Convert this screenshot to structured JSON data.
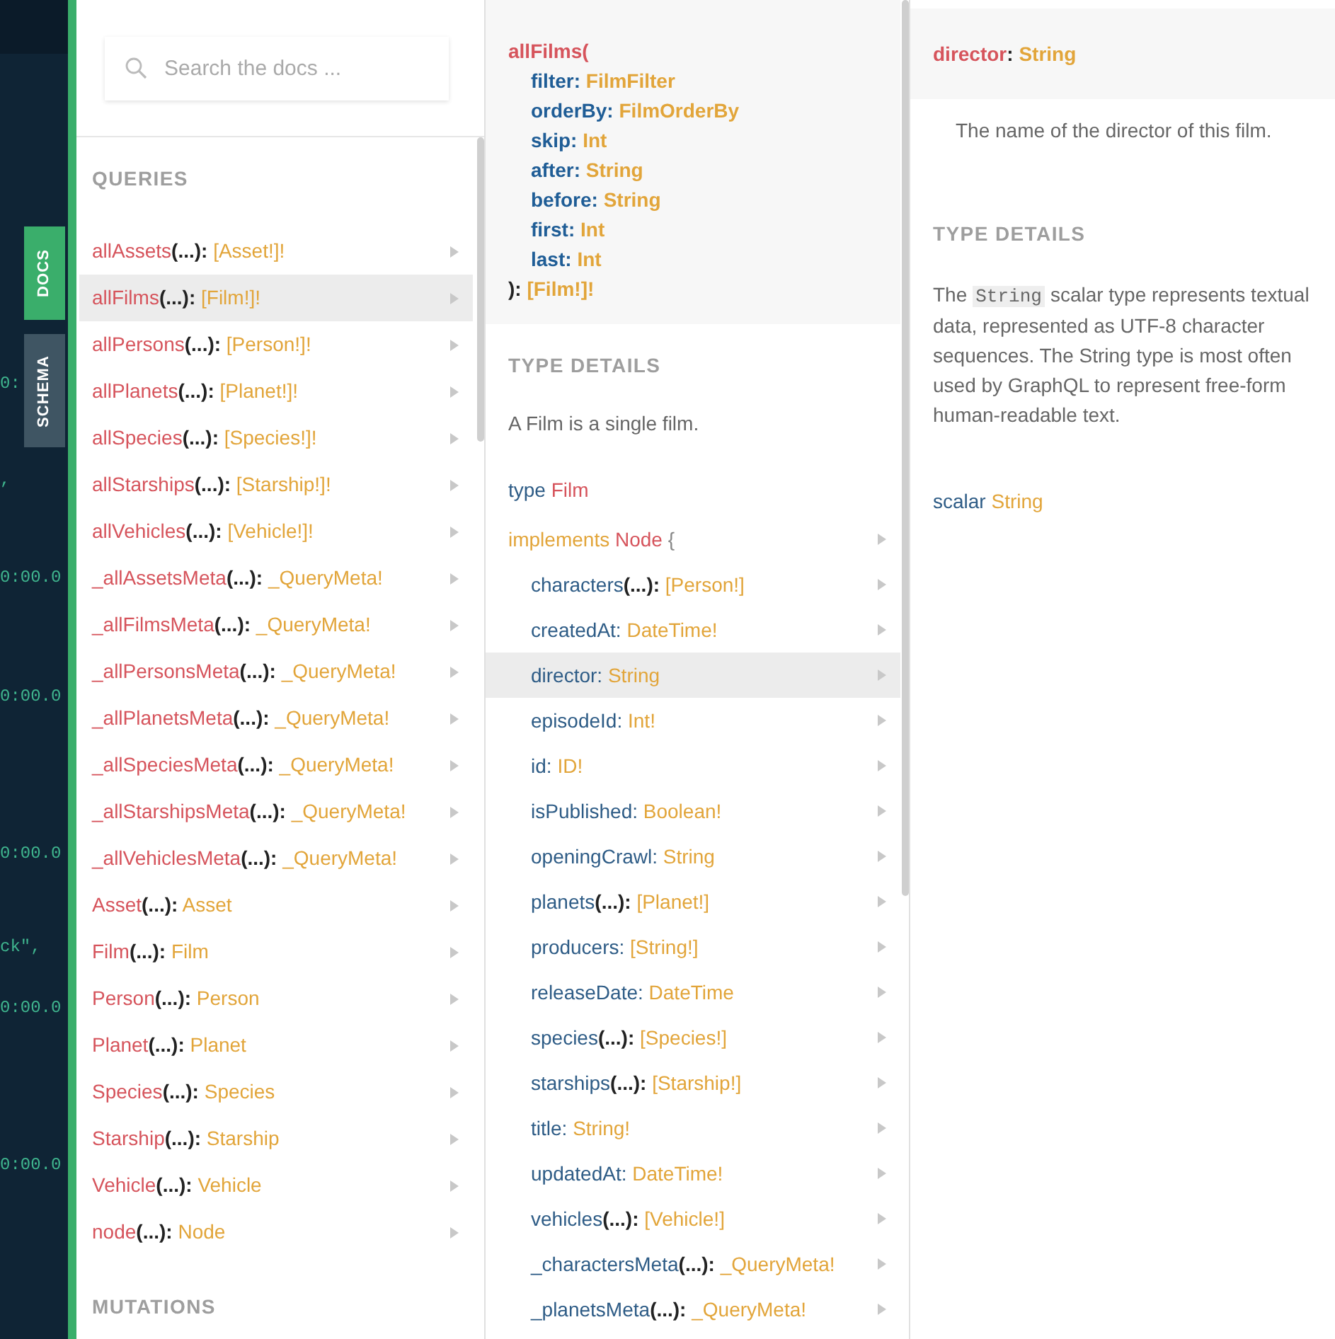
{
  "editor": {
    "fragments": [
      "0:",
      ",",
      "0:00.0",
      "0:00.0",
      "0:00.0",
      "ck\",",
      "0:00.0",
      "0:00.0"
    ]
  },
  "side_tabs": [
    {
      "label": "DOCS",
      "selected": true
    },
    {
      "label": "SCHEMA",
      "selected": false
    }
  ],
  "search": {
    "placeholder": "Search the docs ..."
  },
  "queries": {
    "heading": "QUERIES",
    "items": [
      {
        "name": "allAssets",
        "args": "(...):",
        "type": "[Asset!]!",
        "selected": false
      },
      {
        "name": "allFilms",
        "args": "(...):",
        "type": "[Film!]!",
        "selected": true
      },
      {
        "name": "allPersons",
        "args": "(...):",
        "type": "[Person!]!",
        "selected": false
      },
      {
        "name": "allPlanets",
        "args": "(...):",
        "type": "[Planet!]!",
        "selected": false
      },
      {
        "name": "allSpecies",
        "args": "(...):",
        "type": "[Species!]!",
        "selected": false
      },
      {
        "name": "allStarships",
        "args": "(...):",
        "type": "[Starship!]!",
        "selected": false
      },
      {
        "name": "allVehicles",
        "args": "(...):",
        "type": "[Vehicle!]!",
        "selected": false
      },
      {
        "name": "_allAssetsMeta",
        "args": "(...):",
        "type": "_QueryMeta!",
        "selected": false
      },
      {
        "name": "_allFilmsMeta",
        "args": "(...):",
        "type": "_QueryMeta!",
        "selected": false
      },
      {
        "name": "_allPersonsMeta",
        "args": "(...):",
        "type": "_QueryMeta!",
        "selected": false
      },
      {
        "name": "_allPlanetsMeta",
        "args": "(...):",
        "type": "_QueryMeta!",
        "selected": false
      },
      {
        "name": "_allSpeciesMeta",
        "args": "(...):",
        "type": "_QueryMeta!",
        "selected": false
      },
      {
        "name": "_allStarshipsMeta",
        "args": "(...):",
        "type": "_QueryMeta!",
        "selected": false
      },
      {
        "name": "_allVehiclesMeta",
        "args": "(...):",
        "type": "_QueryMeta!",
        "selected": false
      },
      {
        "name": "Asset",
        "args": "(...):",
        "type": "Asset",
        "selected": false
      },
      {
        "name": "Film",
        "args": "(...):",
        "type": "Film",
        "selected": false
      },
      {
        "name": "Person",
        "args": "(...):",
        "type": "Person",
        "selected": false
      },
      {
        "name": "Planet",
        "args": "(...):",
        "type": "Planet",
        "selected": false
      },
      {
        "name": "Species",
        "args": "(...):",
        "type": "Species",
        "selected": false
      },
      {
        "name": "Starship",
        "args": "(...):",
        "type": "Starship",
        "selected": false
      },
      {
        "name": "Vehicle",
        "args": "(...):",
        "type": "Vehicle",
        "selected": false
      },
      {
        "name": "node",
        "args": "(...):",
        "type": "Node",
        "selected": false
      }
    ],
    "mutations_heading": "MUTATIONS"
  },
  "field_panel": {
    "signature": {
      "name": "allFilms(",
      "args": [
        {
          "name": "filter:",
          "type": "FilmFilter"
        },
        {
          "name": "orderBy:",
          "type": "FilmOrderBy"
        },
        {
          "name": "skip:",
          "type": "Int"
        },
        {
          "name": "after:",
          "type": "String"
        },
        {
          "name": "before:",
          "type": "String"
        },
        {
          "name": "first:",
          "type": "Int"
        },
        {
          "name": "last:",
          "type": "Int"
        }
      ],
      "close": "):",
      "type": "[Film!]!"
    },
    "type_details_heading": "TYPE DETAILS",
    "description": "A Film is a single film.",
    "type_line": {
      "keyword": "type",
      "name": "Film"
    },
    "implements": {
      "keyword": "implements",
      "name": "Node",
      "brace": "{"
    },
    "fields": [
      {
        "name": "characters",
        "args": "(...):",
        "type": "[Person!]",
        "selected": false
      },
      {
        "name": "createdAt:",
        "type": "DateTime!",
        "selected": false
      },
      {
        "name": "director:",
        "type": "String",
        "selected": true
      },
      {
        "name": "episodeId:",
        "type": "Int!",
        "selected": false
      },
      {
        "name": "id:",
        "type": "ID!",
        "selected": false
      },
      {
        "name": "isPublished:",
        "type": "Boolean!",
        "selected": false
      },
      {
        "name": "openingCrawl:",
        "type": "String",
        "selected": false
      },
      {
        "name": "planets",
        "args": "(...):",
        "type": "[Planet!]",
        "selected": false
      },
      {
        "name": "producers:",
        "type": "[String!]",
        "selected": false
      },
      {
        "name": "releaseDate:",
        "type": "DateTime",
        "selected": false
      },
      {
        "name": "species",
        "args": "(...):",
        "type": "[Species!]",
        "selected": false
      },
      {
        "name": "starships",
        "args": "(...):",
        "type": "[Starship!]",
        "selected": false
      },
      {
        "name": "title:",
        "type": "String!",
        "selected": false
      },
      {
        "name": "updatedAt:",
        "type": "DateTime!",
        "selected": false
      },
      {
        "name": "vehicles",
        "args": "(...):",
        "type": "[Vehicle!]",
        "selected": false
      },
      {
        "name": "_charactersMeta",
        "args": "(...):",
        "type": "_QueryMeta!",
        "selected": false
      },
      {
        "name": "_planetsMeta",
        "args": "(...):",
        "type": "_QueryMeta!",
        "selected": false
      }
    ]
  },
  "detail_panel": {
    "header": {
      "name": "director",
      "colon": ":",
      "type": "String"
    },
    "description": "The name of the director of this film.",
    "type_details_heading": "TYPE DETAILS",
    "type_description": [
      {
        "kind": "text",
        "text": "The"
      },
      {
        "kind": "code",
        "text": "String"
      },
      {
        "kind": "text",
        "text": "scalar type represents textual data, represented as UTF-8 character sequences. The String type is most often used by GraphQL to represent free-form human-readable text."
      }
    ],
    "scalar_line": {
      "keyword": "scalar",
      "name": "String"
    }
  }
}
